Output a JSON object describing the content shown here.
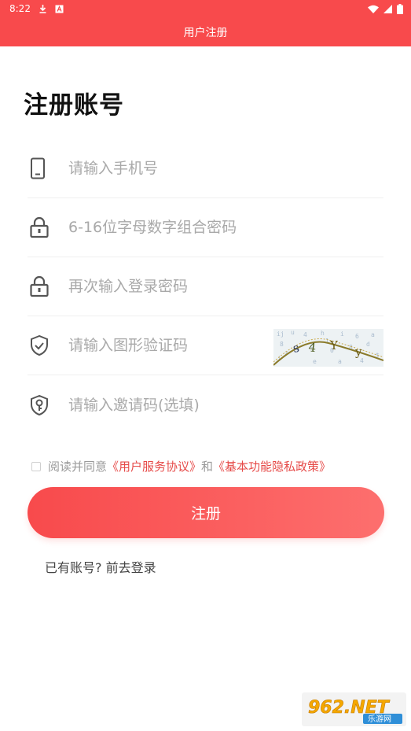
{
  "status_bar": {
    "time": "8:22"
  },
  "app_bar": {
    "title": "用户注册"
  },
  "page": {
    "heading": "注册账号"
  },
  "form": {
    "phone": {
      "placeholder": "请输入手机号",
      "value": ""
    },
    "password": {
      "placeholder": "6-16位字母数字组合密码",
      "value": ""
    },
    "confirm_password": {
      "placeholder": "再次输入登录密码",
      "value": ""
    },
    "captcha": {
      "placeholder": "请输入图形验证码",
      "value": ""
    },
    "invite_code": {
      "placeholder": "请输入邀请码(选填)",
      "value": ""
    }
  },
  "agreement": {
    "checked": false,
    "prefix": "阅读并同意",
    "user_agreement": "《用户服务协议》",
    "conjunction": "和",
    "privacy_policy": "《基本功能隐私政策》"
  },
  "register_button": {
    "label": "注册"
  },
  "login_prompt": {
    "label": "已有账号? 前去登录"
  },
  "watermark": {
    "text": "962.NET",
    "subtext": "乐游网"
  },
  "colors": {
    "primary": "#f84a4c",
    "link": "#e64a48",
    "placeholder": "#a9a9a9"
  },
  "icons": {
    "phone": "phone-icon",
    "password": "lock-icon",
    "confirm_password": "lock-icon",
    "captcha": "shield-check-icon",
    "invite_code": "shield-key-icon"
  }
}
